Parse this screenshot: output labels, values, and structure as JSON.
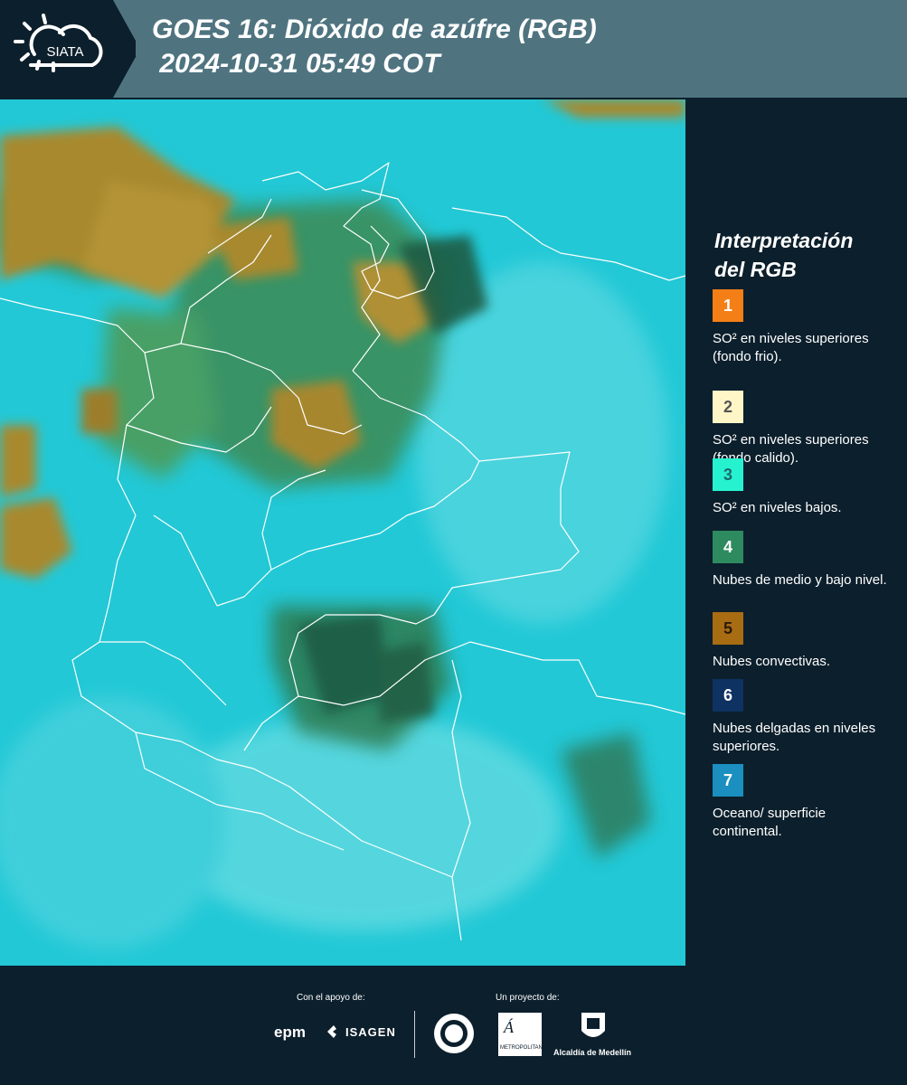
{
  "header": {
    "logo_text": "SIATA",
    "title_line1": "GOES 16: Dióxido de azúfre (RGB)",
    "title_line2": " 2024-10-31 05:49 COT"
  },
  "legend": {
    "title_line1": "Interpretación",
    "title_line2": "del RGB",
    "items": [
      {
        "num": "1",
        "color": "#f57f17",
        "text": "SO² en niveles superiores (fondo frio)."
      },
      {
        "num": "2",
        "color": "#fff6c8",
        "text": "SO² en niveles superiores (fondo calido)."
      },
      {
        "num": "3",
        "color": "#27f2d0",
        "text": "SO² en niveles bajos."
      },
      {
        "num": "4",
        "color": "#2e8a5f",
        "text": "Nubes de medio y bajo nivel."
      },
      {
        "num": "5",
        "color": "#a86c12",
        "text": "Nubes convectivas."
      },
      {
        "num": "6",
        "color": "#0e3261",
        "text": "Nubes delgadas en niveles superiores."
      },
      {
        "num": "7",
        "color": "#1a8fc0",
        "text": "Oceano/ superficie continental."
      }
    ]
  },
  "footer": {
    "support_label": "Con el apoyo de:",
    "project_label": "Un proyecto de:",
    "sponsors": [
      "epm",
      "ISAGEN"
    ],
    "partners_text": [
      "METROPOLITANA",
      "Alcaldía de Medellín"
    ]
  },
  "map_colors": {
    "ocean": "#22c8d6",
    "cloud_brown": "#a8892e",
    "cloud_green": "#3d8a52",
    "dark_green": "#1f5b45",
    "border": "#ffffff"
  }
}
